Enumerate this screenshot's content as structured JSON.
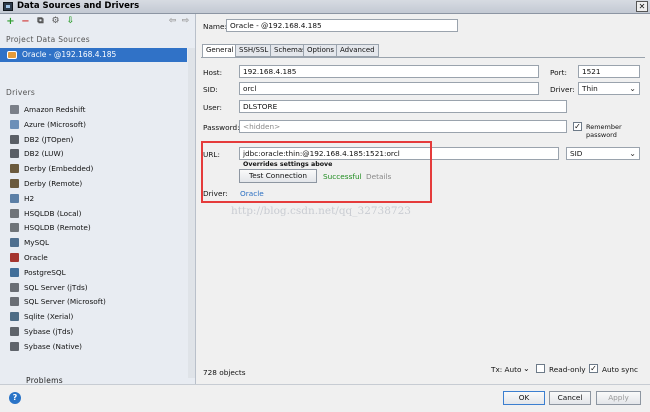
{
  "window": {
    "title": "Data Sources and Drivers",
    "close_glyph": "✕"
  },
  "toolbar": {
    "add": "+",
    "remove": "−",
    "copy": "⧉",
    "settings": "⚙",
    "import": "⇩",
    "back": "⇦",
    "forward": "⇨"
  },
  "left": {
    "project_header": "Project Data Sources",
    "project_item": "Oracle - @192.168.4.185",
    "drivers_header": "Drivers",
    "drivers": [
      "Amazon Redshift",
      "Azure (Microsoft)",
      "DB2 (JTOpen)",
      "DB2 (LUW)",
      "Derby (Embedded)",
      "Derby (Remote)",
      "H2",
      "HSQLDB (Local)",
      "HSQLDB (Remote)",
      "MySQL",
      "Oracle",
      "PostgreSQL",
      "SQL Server (jTds)",
      "SQL Server (Microsoft)",
      "Sqlite (Xerial)",
      "Sybase (jTds)",
      "Sybase (Native)"
    ],
    "problems": "Problems"
  },
  "form": {
    "name_label": "Name:",
    "name_value": "Oracle - @192.168.4.185",
    "tabs": [
      "General",
      "SSH/SSL",
      "Schemas",
      "Options",
      "Advanced"
    ],
    "host_label": "Host:",
    "host_value": "192.168.4.185",
    "port_label": "Port:",
    "port_value": "1521",
    "sid_label": "SID:",
    "sid_value": "orcl",
    "driver_label": "Driver:",
    "driver_value": "Thin",
    "user_label": "User:",
    "user_value": "DLSTORE",
    "password_label": "Password:",
    "password_placeholder": "<hidden>",
    "remember_label": "Remember password",
    "url_label": "URL:",
    "url_value": "jdbc:oracle:thin:@192.168.4.185:1521:orcl",
    "url_mode": "SID",
    "overrides_note": "Overrides settings above",
    "test_button": "Test Connection",
    "status": "Successful",
    "details": "Details",
    "driver_row_label": "Driver:",
    "driver_link": "Oracle"
  },
  "watermark": "http://blog.csdn.net/qq_32738723",
  "status_bar": {
    "objects": "728 objects",
    "tx_label": "Tx: Auto",
    "readonly_label": "Read-only",
    "autosync_label": "Auto sync"
  },
  "footer": {
    "help": "?",
    "ok": "OK",
    "cancel": "Cancel",
    "apply": "Apply"
  },
  "colors": {
    "selection": "#3072c7",
    "success": "#1e8c1e",
    "link": "#2a6fc2",
    "highlight_box": "#e53b3b"
  }
}
